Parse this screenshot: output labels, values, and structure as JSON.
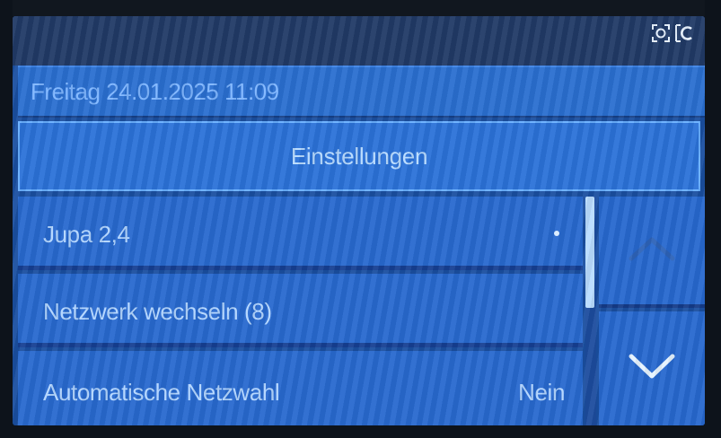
{
  "status_icons": [
    {
      "name": "camera-icon"
    },
    {
      "name": "c-icon"
    }
  ],
  "header": {
    "datetime": "Freitag 24.01.2025 11:09"
  },
  "page": {
    "title": "Einstellungen"
  },
  "menu": {
    "items": [
      {
        "label": "Jupa 2,4",
        "value": ""
      },
      {
        "label": "Netzwerk wechseln (8)",
        "value": ""
      },
      {
        "label": "Automatische Netzwahl",
        "value": "Nein"
      }
    ]
  },
  "nav": {
    "up_icon": "chevron-up-icon",
    "down_icon": "chevron-down-icon"
  },
  "colors": {
    "screen_bg": "#1a4fa0",
    "row_bg": "#2869cf",
    "text": "#b3d6ff",
    "accent_border": "#69b0ff"
  }
}
